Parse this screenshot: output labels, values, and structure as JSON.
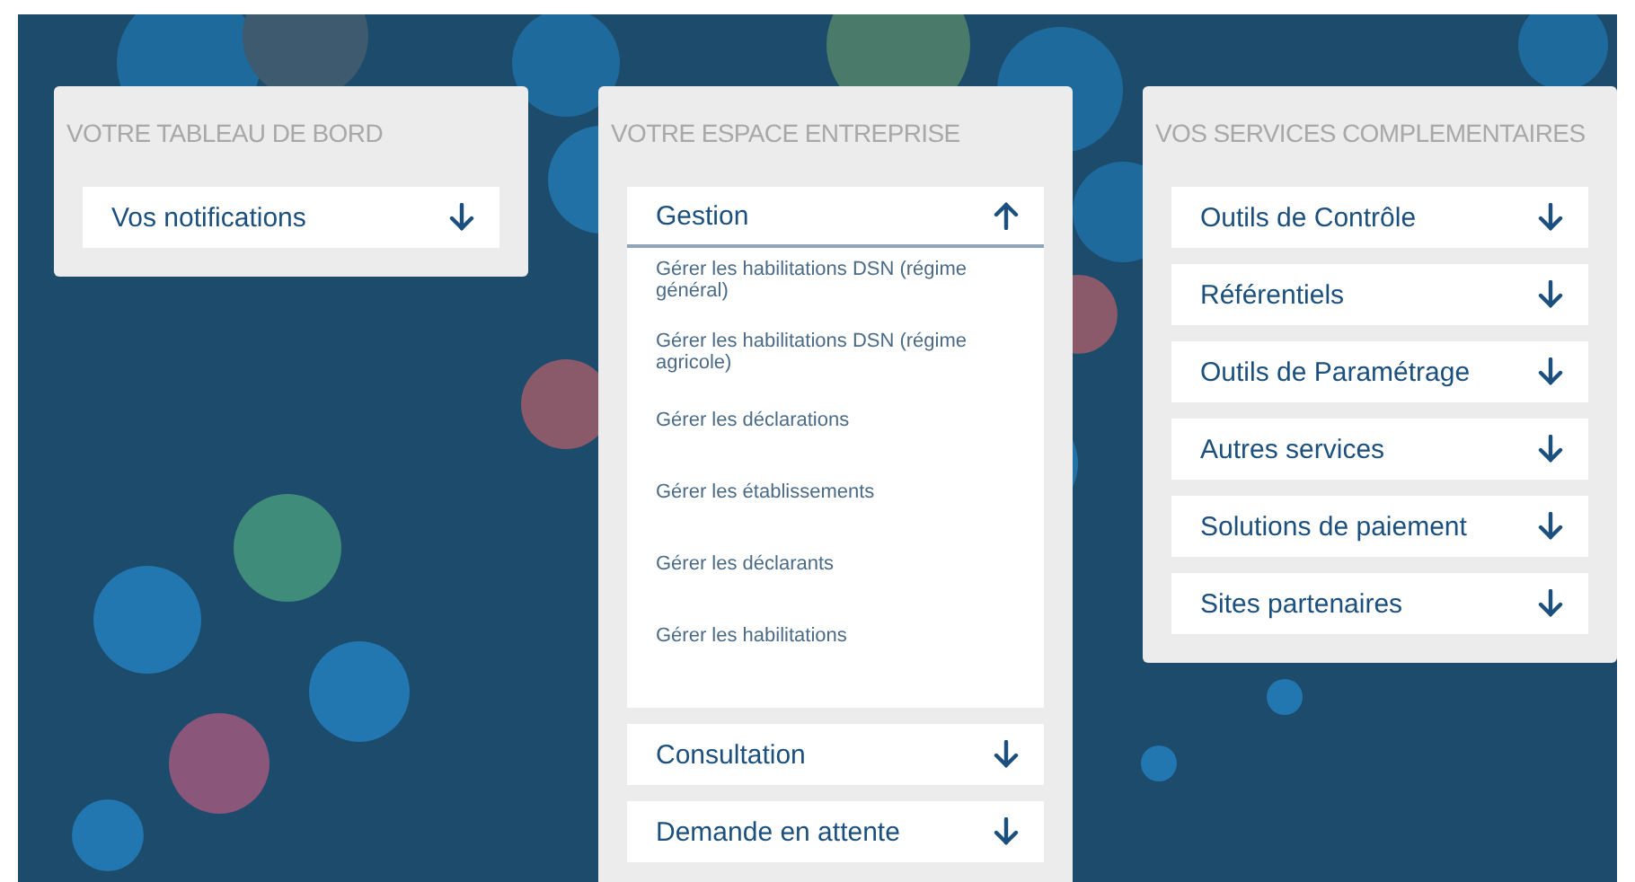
{
  "panels": [
    {
      "title": "VOTRE TABLEAU DE BORD",
      "items": [
        {
          "label": "Vos notifications",
          "expanded": false
        }
      ]
    },
    {
      "title": "VOTRE ESPACE ENTREPRISE",
      "items": [
        {
          "label": "Gestion",
          "expanded": true,
          "links": [
            "Gérer les habilitations DSN (régime général)",
            "Gérer les habilitations DSN (régime agricole)",
            "Gérer les déclarations",
            "Gérer les établissements",
            "Gérer les déclarants",
            "Gérer les habilitations"
          ]
        },
        {
          "label": "Consultation",
          "expanded": false
        },
        {
          "label": "Demande en attente",
          "expanded": false
        }
      ]
    },
    {
      "title": "VOS SERVICES COMPLEMENTAIRES",
      "items": [
        {
          "label": "Outils de Contrôle",
          "expanded": false
        },
        {
          "label": "Référentiels",
          "expanded": false
        },
        {
          "label": "Outils de Paramétrage",
          "expanded": false
        },
        {
          "label": "Autres services",
          "expanded": false
        },
        {
          "label": "Solutions de paiement",
          "expanded": false
        },
        {
          "label": "Sites partenaires",
          "expanded": false
        }
      ]
    }
  ]
}
